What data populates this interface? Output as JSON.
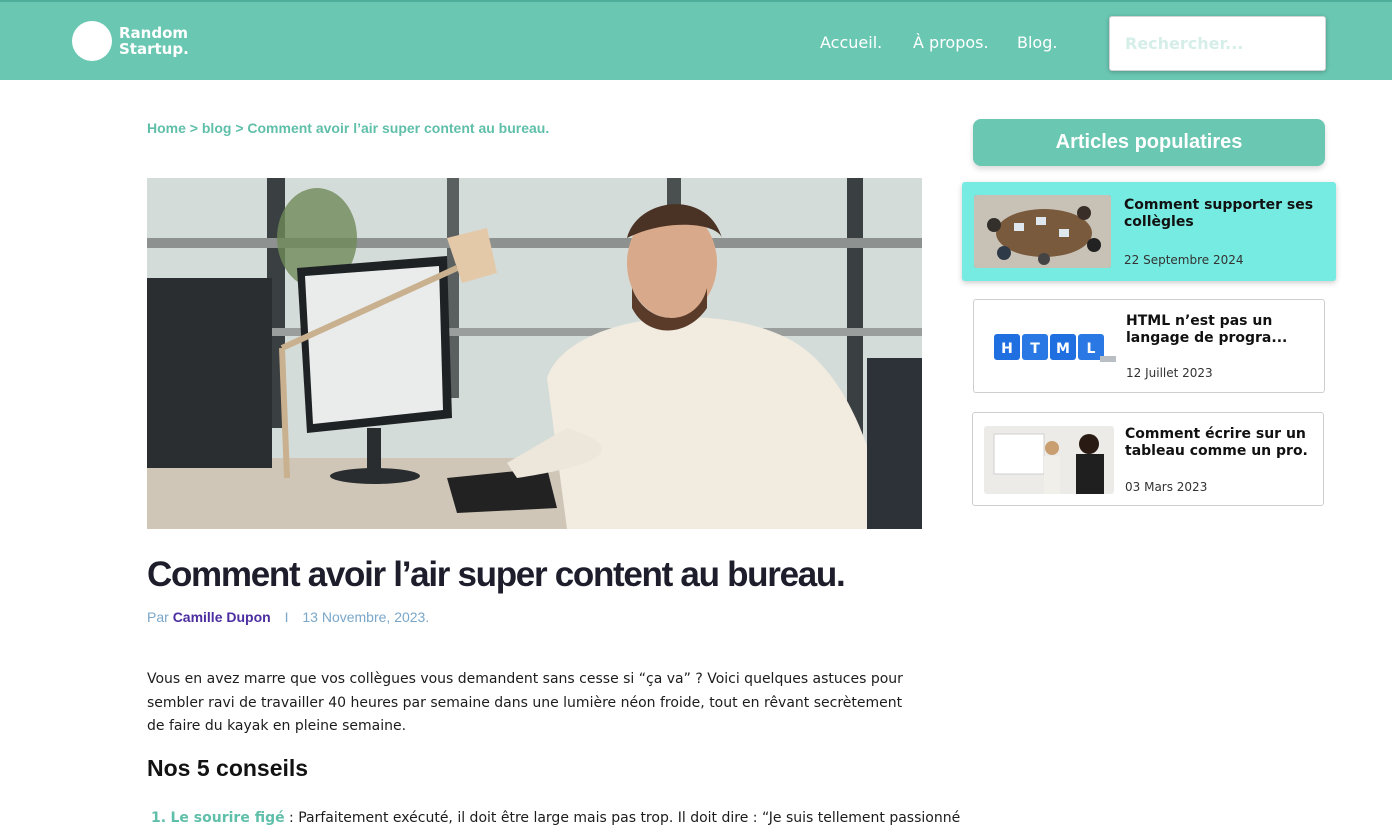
{
  "header": {
    "logo_line1": "Random",
    "logo_line2": "Startup.",
    "nav": [
      "Accueil.",
      "À propos.",
      "Blog."
    ],
    "search_placeholder": "Rechercher..."
  },
  "breadcrumb": {
    "home": "Home",
    "sep": ">",
    "blog": "blog",
    "current": "Comment avoir l’air super content au bureau."
  },
  "article": {
    "title": "Comment avoir l’air super content au bureau.",
    "by_label": "Par",
    "author": "Camille Dupon",
    "separator": "I",
    "date": "13 Novembre, 2023.",
    "intro": "Vous en avez marre que vos collègues vous demandent sans cesse si “ça va” ? Voici quelques astuces pour sembler ravi de travailler 40 heures par semaine dans une lumière néon froide, tout en rêvant secrètement de faire du kayak en pleine semaine.",
    "subtitle": "Nos 5 conseils",
    "tip1_number": "1.",
    "tip1_title": "Le sourire figé",
    "tip1_text": " : Parfaitement exécuté, il doit être large mais pas trop. Il doit dire : “Je suis tellement passionné"
  },
  "sidebar": {
    "title": "Articles populatires",
    "articles": [
      {
        "title": "Comment supporter ses collègles",
        "date": "22 Septembre 2024"
      },
      {
        "title": "HTML n’est pas un langage de progra...",
        "date": "12 Juillet 2023"
      },
      {
        "title": "Comment écrire sur un tableau comme un pro.",
        "date": "03 Mars 2023"
      }
    ],
    "html_cube_letters": [
      "H",
      "T",
      "M",
      "L"
    ]
  },
  "colors": {
    "accent": "#6ac7b2",
    "active_card": "#76ebe1",
    "author": "#4c2ea0",
    "date": "#7aa7c9"
  }
}
